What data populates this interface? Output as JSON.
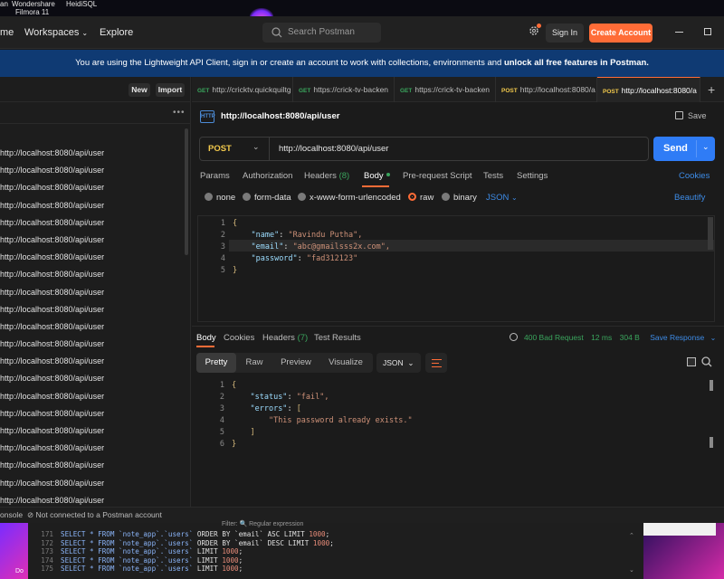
{
  "desktop": {
    "labels": [
      "an",
      "Wondershare",
      "HeidiSQL",
      "Filmora 11"
    ]
  },
  "header": {
    "nav": [
      "me",
      "Workspaces",
      "Explore"
    ],
    "search_placeholder": "Search Postman",
    "signin": "Sign In",
    "create_account": "Create Account"
  },
  "banner": {
    "text_a": "You are using the Lightweight API Client, sign in or create an account to work with collections, environments and ",
    "text_b": "unlock all free features in Postman."
  },
  "sidebar": {
    "new": "New",
    "import": "Import",
    "history": [
      "http://localhost:8080/api/user",
      "http://localhost:8080/api/user",
      "http://localhost:8080/api/user",
      "http://localhost:8080/api/user",
      "http://localhost:8080/api/user",
      "http://localhost:8080/api/user",
      "http://localhost:8080/api/user",
      "http://localhost:8080/api/user",
      "http://localhost:8080/api/user",
      "http://localhost:8080/api/user",
      "http://localhost:8080/api/user",
      "http://localhost:8080/api/user",
      "http://localhost:8080/api/user",
      "http://localhost:8080/api/user",
      "http://localhost:8080/api/user",
      "http://localhost:8080/api/user",
      "http://localhost:8080/api/user",
      "http://localhost:8080/api/user",
      "http://localhost:8080/api/user",
      "http://localhost:8080/api/user",
      "http://localhost:8080/api/user"
    ]
  },
  "tabs": [
    {
      "method": "GET",
      "label": "http://cricktv.quickquiltg"
    },
    {
      "method": "GET",
      "label": "https://crick-tv-backen"
    },
    {
      "method": "GET",
      "label": "https://crick-tv-backen"
    },
    {
      "method": "POST",
      "label": "http://localhost:8080/a"
    },
    {
      "method": "POST",
      "label": "http://localhost:8080/a"
    }
  ],
  "request": {
    "title": "http://localhost:8080/api/user",
    "save": "Save",
    "method": "POST",
    "url": "http://localhost:8080/api/user",
    "send": "Send",
    "tabs": {
      "params": "Params",
      "authorization": "Authorization",
      "headers": "Headers",
      "headers_count": "(8)",
      "body": "Body",
      "prerequest": "Pre-request Script",
      "tests": "Tests",
      "settings": "Settings"
    },
    "cookies": "Cookies",
    "body_types": {
      "none": "none",
      "form_data": "form-data",
      "urlencoded": "x-www-form-urlencoded",
      "raw": "raw",
      "binary": "binary"
    },
    "format": "JSON",
    "beautify": "Beautify",
    "body_lines": [
      {
        "n": "1",
        "k": "",
        "v": ""
      },
      {
        "n": "2",
        "k": "\"name\"",
        "v": "\"Ravindu Putha\","
      },
      {
        "n": "3",
        "k": "\"email\"",
        "v": "\"abc@gmailsss2x.com\","
      },
      {
        "n": "4",
        "k": "\"password\"",
        "v": "\"fad312123\""
      },
      {
        "n": "5",
        "k": "",
        "v": ""
      }
    ]
  },
  "response": {
    "tabs": {
      "body": "Body",
      "cookies": "Cookies",
      "headers": "Headers",
      "headers_count": "(7)",
      "test_results": "Test Results"
    },
    "status": "400 Bad Request",
    "time": "12 ms",
    "size": "304 B",
    "save_response": "Save Response",
    "views": [
      "Pretty",
      "Raw",
      "Preview",
      "Visualize"
    ],
    "format": "JSON",
    "lines": [
      {
        "n": "1"
      },
      {
        "n": "2",
        "k": "\"status\"",
        "v": "\"fail\","
      },
      {
        "n": "3",
        "k": "\"errors\"",
        "v": "["
      },
      {
        "n": "4",
        "v": "\"This password already exists.\""
      },
      {
        "n": "5",
        "v": "]"
      },
      {
        "n": "6"
      }
    ]
  },
  "statusbar": {
    "console": "onsole",
    "status": "Not connected to a Postman account"
  },
  "heidi": {
    "filter_label": "Filter: 🔍 Regular expression",
    "left_label": "Do",
    "rows": [
      {
        "n": "171",
        "order": "ORDER BY `email` ASC LIMIT",
        "num": "1000"
      },
      {
        "n": "172",
        "order": "ORDER BY `email` DESC LIMIT",
        "num": "1000"
      },
      {
        "n": "173",
        "order": "LIMIT",
        "num": "1000"
      },
      {
        "n": "174",
        "order": "LIMIT",
        "num": "1000"
      },
      {
        "n": "175",
        "order": "LIMIT",
        "num": "1000"
      }
    ],
    "select": "SELECT * FROM `note_app`.`users`"
  }
}
